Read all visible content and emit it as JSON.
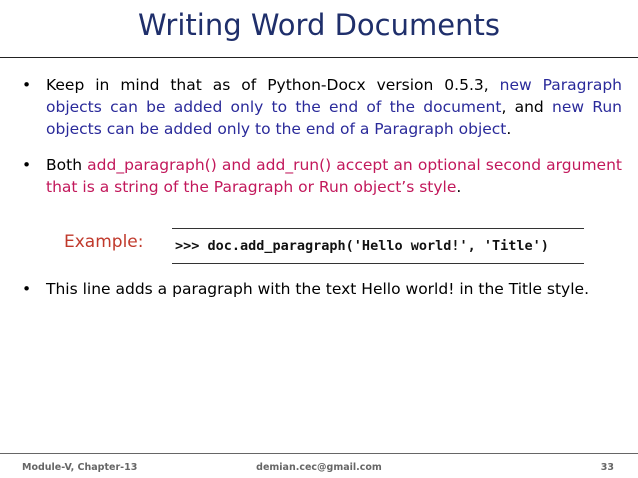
{
  "title": "Writing Word Documents",
  "bullets": [
    {
      "symbol": "•",
      "parts": [
        "Keep in mind that as of Python-Docx version 0.5.3, ",
        "new Paragraph objects can be added only to the end of the document",
        ", and ",
        "new Run objects can be added only to the end of a Paragraph object",
        "."
      ]
    },
    {
      "symbol": "•",
      "parts": [
        "Both ",
        "add_paragraph() and add_run() accept an optional second argument that is a string of the Paragraph or Run object’s style",
        "."
      ]
    },
    {
      "symbol": "•",
      "parts": [
        "This line adds a paragraph with the text Hello world! in the Title style."
      ]
    }
  ],
  "example": {
    "label": "Example:",
    "code": ">>> doc.add_paragraph('Hello world!', 'Title')"
  },
  "footer": {
    "left": "Module-V, Chapter-13",
    "center": "demian.cec@gmail.com",
    "right": "33"
  },
  "colors": {
    "title": "#1f2f6b",
    "highlight_blue": "#2a2a9a",
    "highlight_magenta": "#c2185b",
    "example_label": "#c0392b"
  }
}
